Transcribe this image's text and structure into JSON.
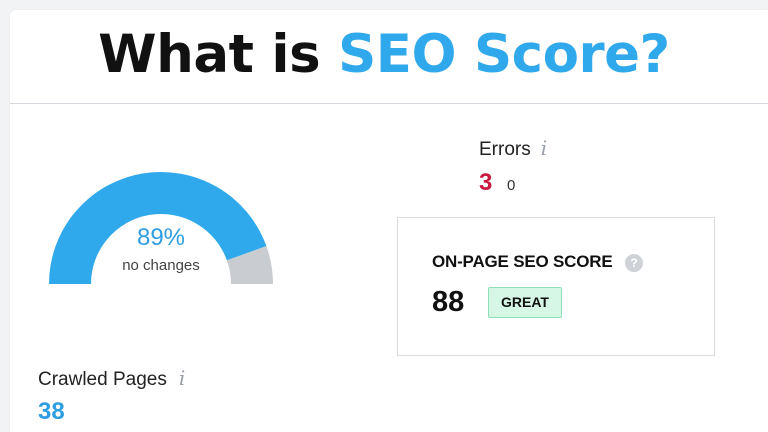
{
  "headline": {
    "prefix": "What is ",
    "highlight": "SEO Score?",
    "accent_color": "#2fa8ec"
  },
  "site_health": {
    "percent": 89,
    "value_label": "89%",
    "subtitle": "no changes",
    "fill_color": "#2fa8ec",
    "track_color": "#c9ccd1"
  },
  "errors": {
    "label": "Errors",
    "info_icon": "i",
    "value": "3",
    "delta": "0",
    "color": "#c8193f"
  },
  "on_page_seo": {
    "label": "ON-PAGE SEO SCORE",
    "help_icon": "?",
    "score": "88",
    "badge": "GREAT",
    "badge_color": "#d6f6e6"
  },
  "crawled_pages": {
    "label": "Crawled Pages",
    "info_icon": "i",
    "value": "38"
  }
}
